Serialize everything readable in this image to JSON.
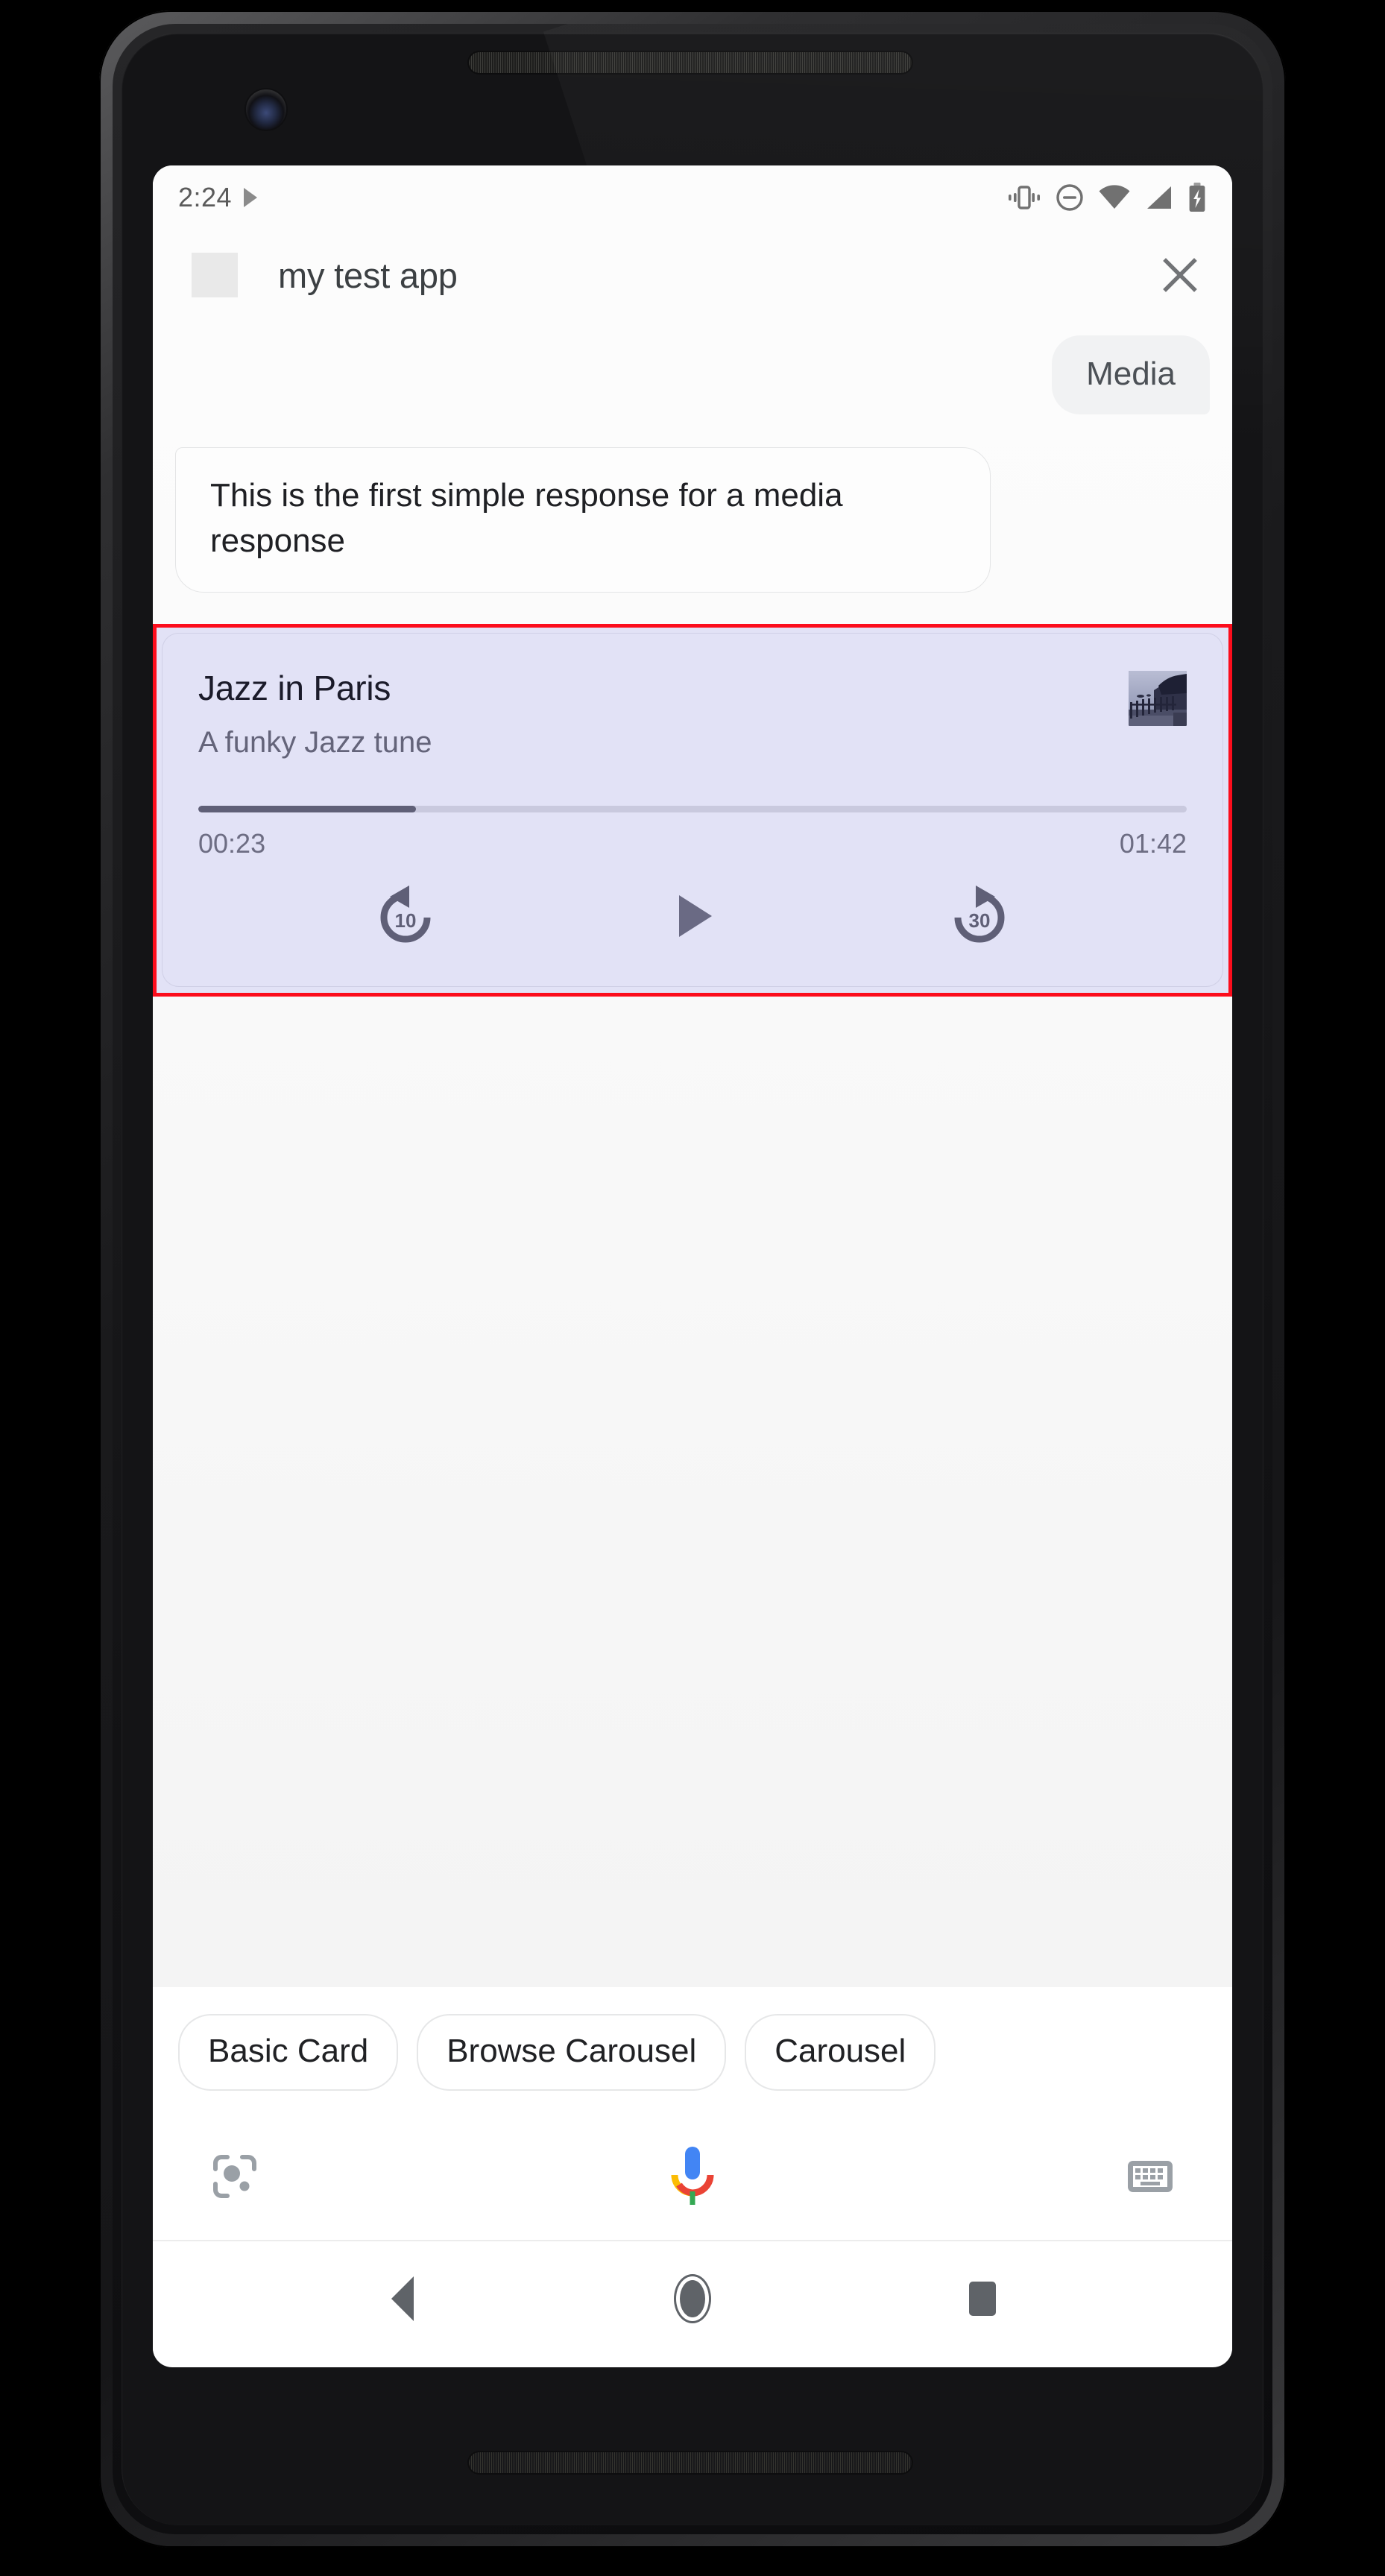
{
  "status_bar": {
    "time": "2:24",
    "left_icons": [
      "play-triangle-icon"
    ],
    "right_icons": [
      "vibrate-icon",
      "do-not-disturb-icon",
      "wifi-icon",
      "cellular-signal-icon",
      "battery-charging-icon"
    ]
  },
  "app_header": {
    "title": "my test app",
    "close_label": "✕",
    "icon": "app-placeholder-icon"
  },
  "conversation": {
    "user_message": "Media",
    "agent_message": "This is the first simple response for a media response"
  },
  "media_card": {
    "title": "Jazz in Paris",
    "subtitle": "A funky Jazz tune",
    "current_time": "00:23",
    "total_time": "01:42",
    "progress_percent": 22,
    "album_art": "album-art-fence-seaside",
    "controls": [
      {
        "name": "replay-10-button",
        "label": "10"
      },
      {
        "name": "play-button",
        "label": "play"
      },
      {
        "name": "forward-30-button",
        "label": "30"
      }
    ],
    "colors": {
      "card_background": "#E2E2F6",
      "highlight_border": "#FC0D1C",
      "progress_fill": "#5F5F77",
      "progress_track": "#C9C9DE",
      "title_text": "#1B1B2A",
      "subtitle_text": "#64647A"
    }
  },
  "suggestion_chips": [
    {
      "label": "Basic Card"
    },
    {
      "label": "Browse Carousel"
    },
    {
      "label": "Carousel"
    }
  ],
  "assistant_bar": {
    "lens_icon": "google-lens-icon",
    "mic_icon": "google-assistant-mic-icon",
    "keyboard_icon": "keyboard-icon"
  },
  "nav_bar": {
    "back": "back-icon",
    "home": "home-icon",
    "recents": "recents-icon"
  }
}
